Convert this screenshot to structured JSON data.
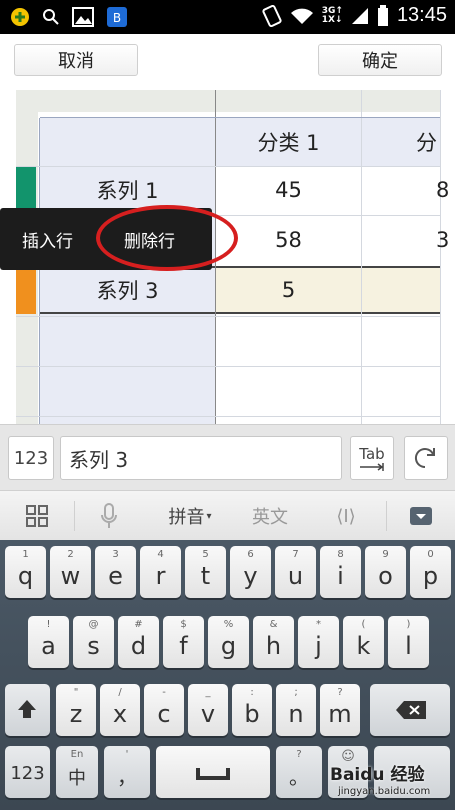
{
  "status": {
    "time": "13:45",
    "network": "3G↑\n1X↓"
  },
  "topbar": {
    "cancel_label": "取消",
    "ok_label": "确定"
  },
  "sheet": {
    "header": [
      "",
      "分类 1",
      "分"
    ],
    "rows": [
      {
        "label": "系列 1",
        "v1": "45",
        "v2": "8",
        "color": "#12946c"
      },
      {
        "label": "",
        "v1": "58",
        "v2": "3",
        "color": "#1e5aa8"
      },
      {
        "label": "系列 3",
        "v1": "5",
        "v2": "",
        "color": "#f0901e"
      }
    ]
  },
  "popup": {
    "insert_row": "插入行",
    "delete_row": "删除行"
  },
  "inputbar": {
    "num_label": "123",
    "text_value": "系列 3",
    "tab_label": "Tab"
  },
  "kbtoolbar": {
    "pinyin_label": "拼音",
    "english_label": "英文",
    "cursor_label": "⟨I⟩"
  },
  "keyboard": {
    "row1": [
      {
        "main": "q",
        "sub": "1"
      },
      {
        "main": "w",
        "sub": "2"
      },
      {
        "main": "e",
        "sub": "3"
      },
      {
        "main": "r",
        "sub": "4"
      },
      {
        "main": "t",
        "sub": "5"
      },
      {
        "main": "y",
        "sub": "6"
      },
      {
        "main": "u",
        "sub": "7"
      },
      {
        "main": "i",
        "sub": "8"
      },
      {
        "main": "o",
        "sub": "9"
      },
      {
        "main": "p",
        "sub": "0"
      }
    ],
    "row2": [
      {
        "main": "a",
        "sub": "!"
      },
      {
        "main": "s",
        "sub": "@"
      },
      {
        "main": "d",
        "sub": "#"
      },
      {
        "main": "f",
        "sub": "$"
      },
      {
        "main": "g",
        "sub": "%"
      },
      {
        "main": "h",
        "sub": "&"
      },
      {
        "main": "j",
        "sub": "*"
      },
      {
        "main": "k",
        "sub": "("
      },
      {
        "main": "l",
        "sub": ")"
      }
    ],
    "row3": [
      {
        "main": "z",
        "sub": "\""
      },
      {
        "main": "x",
        "sub": "/"
      },
      {
        "main": "c",
        "sub": "-"
      },
      {
        "main": "v",
        "sub": "_"
      },
      {
        "main": "b",
        "sub": ":"
      },
      {
        "main": "n",
        "sub": ";"
      },
      {
        "main": "m",
        "sub": "?"
      }
    ],
    "num_key": "123",
    "lang_key_main": "中",
    "lang_key_sub": "En",
    "comma_key": "，",
    "comma_sub": "'",
    "period_key": "。",
    "period_sub": "?",
    "emoji_sub": "☺",
    "watermark": "Baidu 经验",
    "watermark_url": "jingyan.baidu.com"
  }
}
